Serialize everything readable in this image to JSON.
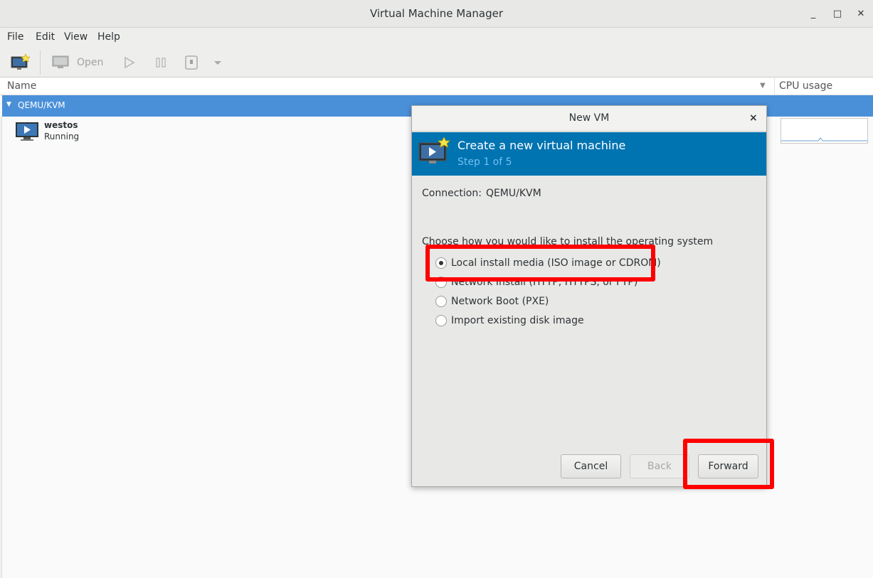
{
  "window": {
    "title": "Virtual Machine Manager",
    "controls": {
      "minimize": "_",
      "maximize": "□",
      "close": "✕"
    }
  },
  "menubar": {
    "items": [
      "File",
      "Edit",
      "View",
      "Help"
    ]
  },
  "toolbar": {
    "new_vm_icon": "new-vm-icon",
    "open_label": "Open",
    "icons": [
      "monitor-icon",
      "play-icon",
      "pause-icon",
      "stop-icon",
      "dropdown-arrow-icon"
    ]
  },
  "list": {
    "columns": {
      "name": "Name",
      "cpu": "CPU usage"
    },
    "group": {
      "label": "QEMU/KVM"
    },
    "vms": [
      {
        "name": "westos",
        "status": "Running"
      }
    ]
  },
  "dialog": {
    "title": "New VM",
    "close_glyph": "×",
    "banner": {
      "title": "Create a new virtual machine",
      "step": "Step 1 of 5"
    },
    "connection": {
      "label": "Connection:",
      "value": "QEMU/KVM"
    },
    "prompt": "Choose how you would like to install the operating system",
    "options": [
      {
        "label": "Local install media (ISO image or CDROM)",
        "checked": true
      },
      {
        "label": "Network Install (HTTP, HTTPS, or FTP)",
        "checked": false
      },
      {
        "label": "Network Boot (PXE)",
        "checked": false
      },
      {
        "label": "Import existing disk image",
        "checked": false
      }
    ],
    "buttons": {
      "cancel": "Cancel",
      "back": "Back",
      "forward": "Forward"
    }
  },
  "colors": {
    "selection": "#4a90d9",
    "banner": "#0073b1",
    "highlight": "#ff0000"
  }
}
